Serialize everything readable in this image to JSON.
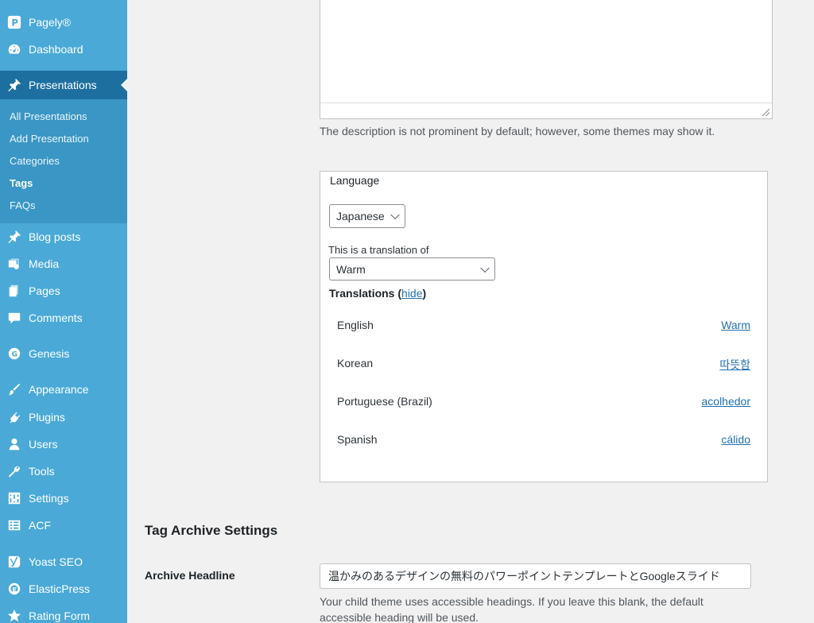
{
  "sidebar": {
    "site_name": "Pagely®",
    "menu": [
      {
        "label": "Dashboard",
        "icon": "dashboard-icon"
      },
      {
        "label": "Presentations",
        "icon": "pin-icon",
        "current": true
      },
      {
        "label": "Blog posts",
        "icon": "pin-icon"
      },
      {
        "label": "Media",
        "icon": "media-icon"
      },
      {
        "label": "Pages",
        "icon": "pages-icon"
      },
      {
        "label": "Comments",
        "icon": "comment-icon"
      },
      {
        "label": "Genesis",
        "icon": "genesis-icon"
      },
      {
        "label": "Appearance",
        "icon": "brush-icon"
      },
      {
        "label": "Plugins",
        "icon": "plug-icon"
      },
      {
        "label": "Users",
        "icon": "user-icon"
      },
      {
        "label": "Tools",
        "icon": "wrench-icon"
      },
      {
        "label": "Settings",
        "icon": "sliders-icon"
      },
      {
        "label": "ACF",
        "icon": "grid-icon"
      },
      {
        "label": "Yoast SEO",
        "icon": "yoast-icon"
      },
      {
        "label": "ElasticPress",
        "icon": "elasticpress-icon"
      },
      {
        "label": "Rating Form",
        "icon": "star-icon"
      }
    ],
    "submenu": [
      "All Presentations",
      "Add Presentation",
      "Categories",
      "Tags",
      "FAQs"
    ],
    "submenu_active": "Tags"
  },
  "description_help": "The description is not prominent by default; however, some themes may show it.",
  "language_box": {
    "title": "Language",
    "selected_language": "Japanese",
    "translation_of_label": "This is a translation of",
    "translation_of_value": "Warm",
    "translations_label": "Translations",
    "hide_label": "hide",
    "translations": [
      {
        "language": "English",
        "value": "Warm"
      },
      {
        "language": "Korean",
        "value": "따뜻함"
      },
      {
        "language": "Portuguese (Brazil)",
        "value": "acolhedor"
      },
      {
        "language": "Spanish",
        "value": "cálido"
      }
    ]
  },
  "archive": {
    "section_title": "Tag Archive Settings",
    "headline_label": "Archive Headline",
    "headline_value": "温かみのあるデザインの無料のパワーポイントテンプレートとGoogleスライド",
    "help_text": "Your child theme uses accessible headings. If you leave this blank, the default accessible heading will be used."
  },
  "colors": {
    "sidebar_bg": "#4aa9d6",
    "sidebar_current": "#1d6fa0",
    "submenu_bg": "#3a96c4",
    "link": "#2271b1"
  }
}
